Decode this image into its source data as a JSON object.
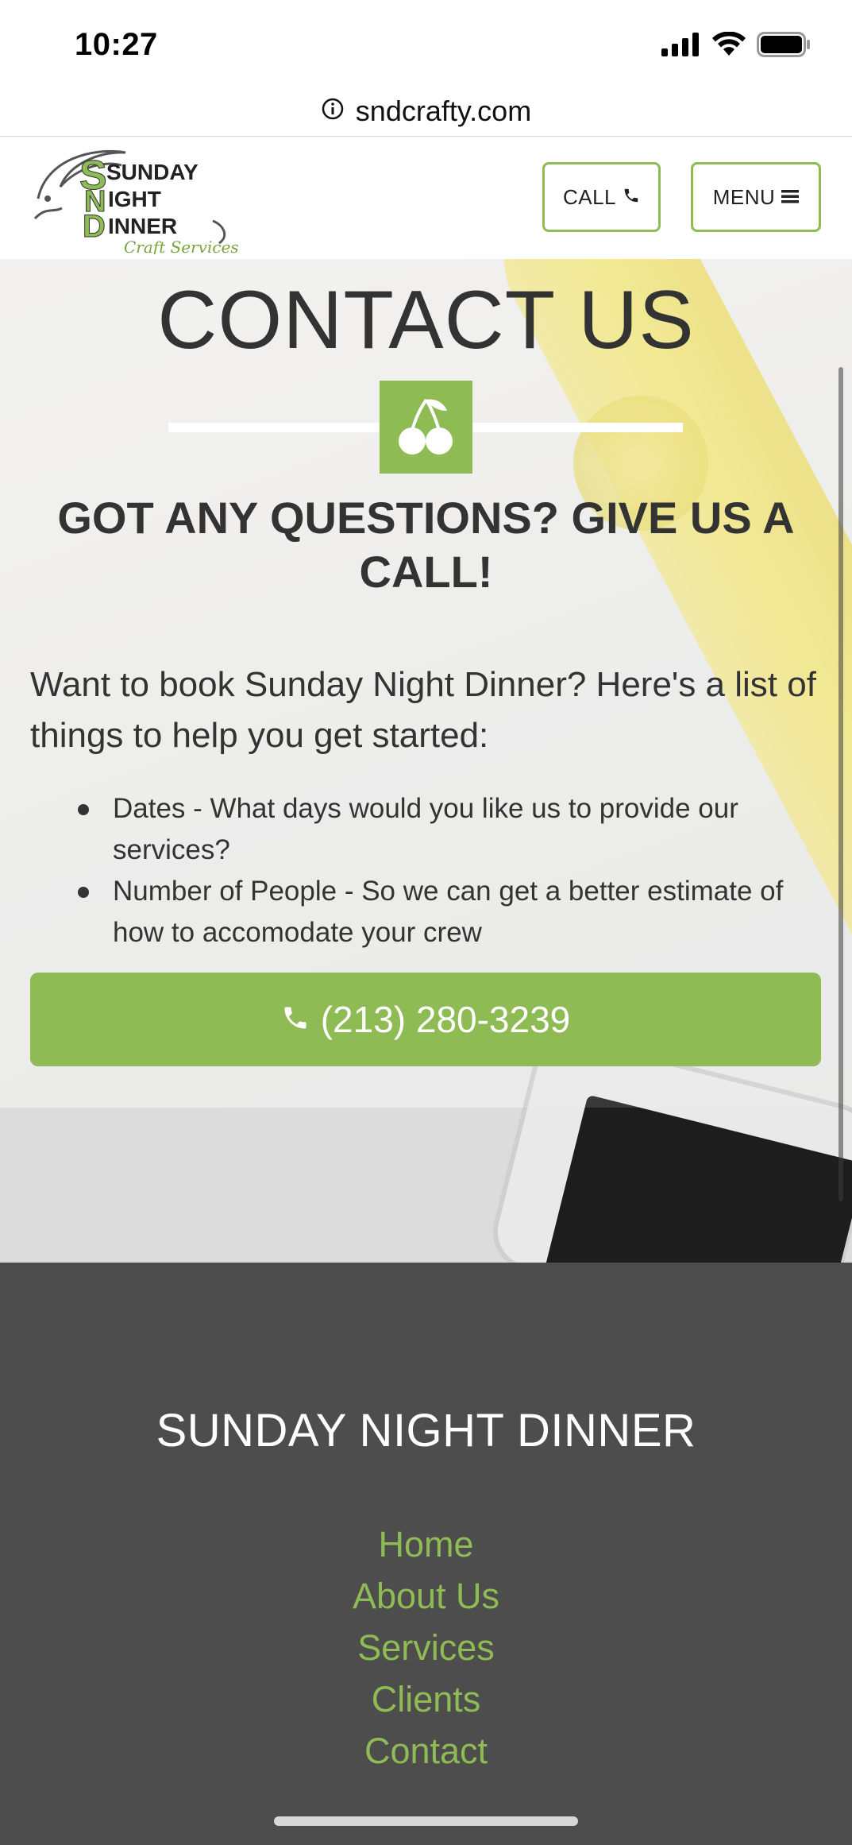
{
  "status_bar": {
    "time": "10:27"
  },
  "browser": {
    "url": "sndcrafty.com"
  },
  "header": {
    "logo_words": [
      "SUNDAY",
      "NIGHT",
      "DINNER"
    ],
    "logo_tagline": "Craft Services",
    "call_label": "CALL",
    "menu_label": "MENU"
  },
  "hero": {
    "title": "CONTACT US",
    "subtitle": "GOT ANY QUESTIONS? GIVE US A CALL!",
    "intro": "Want to book Sunday Night Dinner? Here's a list of things to help you get started:",
    "bullets": [
      "Dates - What days would you like us to provide our services?",
      "Number of People - So we can get a better estimate of how to accomodate your crew"
    ],
    "phone": "(213) 280-3239"
  },
  "footer": {
    "title": "SUNDAY NIGHT DINNER",
    "links": [
      "Home",
      "About Us",
      "Services",
      "Clients",
      "Contact"
    ]
  },
  "colors": {
    "accent": "#8fbb55",
    "footer_bg": "#4d4d4d",
    "text": "#333333"
  },
  "icons": [
    "info-icon",
    "signal-icon",
    "wifi-icon",
    "battery-icon",
    "phone-icon",
    "hamburger-icon",
    "cherry-icon"
  ]
}
